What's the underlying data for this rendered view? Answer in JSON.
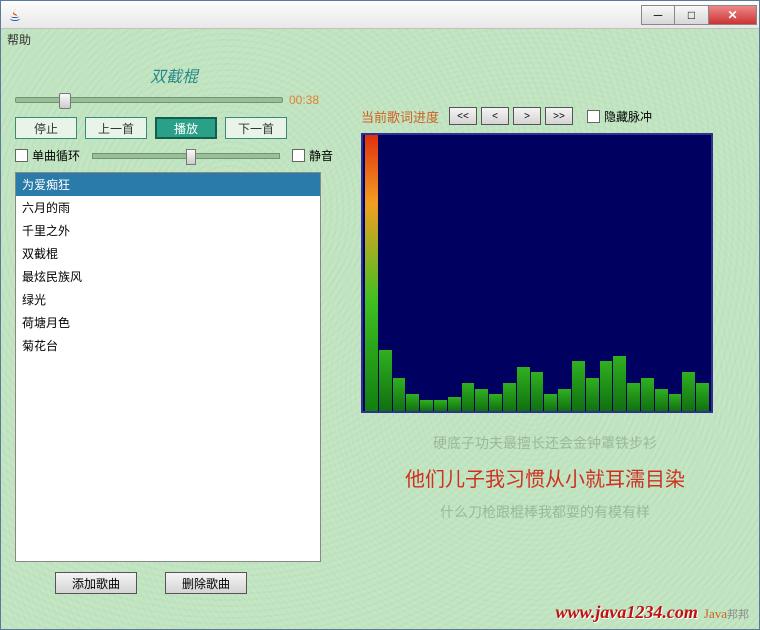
{
  "menubar": {
    "help": "帮助"
  },
  "player": {
    "now_playing": "双截棍",
    "elapsed": "00:38",
    "seek_percent": 16,
    "buttons": {
      "stop": "停止",
      "prev": "上一首",
      "play": "播放",
      "next": "下一首"
    },
    "loop_label": "单曲循环",
    "mute_label": "静音",
    "volume_percent": 50
  },
  "playlist": {
    "items": [
      "为爱痴狂",
      "六月的雨",
      "千里之外",
      "双截棍",
      "最炫民族风",
      "绿光",
      "荷塘月色",
      "菊花台"
    ],
    "selected_index": 0
  },
  "bottom": {
    "add": "添加歌曲",
    "remove": "删除歌曲"
  },
  "right": {
    "lyrics_title": "当前歌词进度",
    "nav": {
      "first": "<<",
      "prev": "<",
      "next": ">",
      "last": ">>"
    },
    "hide_pulse": "隐藏脉冲"
  },
  "chart_data": {
    "type": "bar",
    "title": "audio spectrum",
    "values": [
      100,
      22,
      12,
      6,
      4,
      4,
      5,
      10,
      8,
      6,
      10,
      16,
      14,
      6,
      8,
      18,
      12,
      18,
      20,
      10,
      12,
      8,
      6,
      14,
      10
    ],
    "ylim": [
      0,
      100
    ]
  },
  "lyrics": {
    "prev": "硬底子功夫最擅长还会金钟罩铁步衫",
    "current": "他们儿子我习惯从小就耳濡目染",
    "next": "什么刀枪跟棍棒我都耍的有模有样"
  },
  "watermark": {
    "logo_prefix": "Java",
    "logo_suffix": "邦邦",
    "url": "www.java1234.com"
  }
}
